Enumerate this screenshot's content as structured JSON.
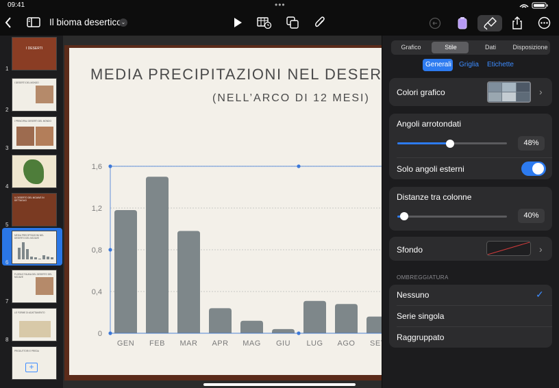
{
  "status_bar": {
    "time": "09:41",
    "center_dots": "•••"
  },
  "toolbar": {
    "document_title": "Il bioma desertico",
    "icons": [
      "back-chevron-icon",
      "sidebar-icon",
      "chevron-down-icon",
      "play-icon",
      "table-insert-icon",
      "shapes-icon",
      "paperclip-icon",
      "undo-icon",
      "collaborate-icon",
      "format-brush-icon",
      "share-icon",
      "more-icon"
    ]
  },
  "sidebar": {
    "slides": [
      {
        "number": "1",
        "title": "I DESERTI"
      },
      {
        "number": "2",
        "title": "I DESERTI DEL MONDO"
      },
      {
        "number": "3",
        "title": "I PRINCIPALI DESERTI DEL MONDO"
      },
      {
        "number": "4",
        "title": ""
      },
      {
        "number": "5",
        "title": "IL DESERTO DEL MOJAVE IN DETTAGLIO"
      },
      {
        "number": "6",
        "title": "MEDIA PRECIPITAZIONI NEL DESERTO DEL MOJAVE"
      },
      {
        "number": "7",
        "title": "FLORA E FAUNA DEL DESERTO DEL MOJAVE"
      },
      {
        "number": "8",
        "title": "LE FORME DI ADATTAMENTO"
      },
      {
        "number": "",
        "title": "PRODUTTORI E PREDA"
      }
    ],
    "selected_index": 5,
    "add_slide_icon": "add-slide-icon"
  },
  "slide": {
    "title": "MEDIA PRECIPITAZIONI NEL DESERTO DEL MOJAVE",
    "subtitle": "(NELL’ARCO DI 12 MESI)"
  },
  "chart_data": {
    "type": "bar",
    "categories": [
      "GEN",
      "FEB",
      "MAR",
      "APR",
      "MAG",
      "GIU",
      "LUG",
      "AGO",
      "SET"
    ],
    "values": [
      1.18,
      1.5,
      0.98,
      0.24,
      0.12,
      0.04,
      0.31,
      0.28,
      0.16
    ],
    "ylim": [
      0,
      1.6
    ],
    "yticks": [
      "0",
      "0,4",
      "0,8",
      "1,2",
      "1,6"
    ],
    "grid": true,
    "bar_color": "#7e878a"
  },
  "panel": {
    "tabs": [
      "Grafico",
      "Stile",
      "Dati",
      "Disposizione"
    ],
    "selected_tab": "Stile",
    "subtabs": [
      "Generali",
      "Griglia",
      "Etichette"
    ],
    "selected_subtab": "Generali",
    "chart_colors_label": "Colori grafico",
    "rounded_corners_label": "Angoli arrotondati",
    "rounded_corners_value": "48%",
    "rounded_corners_fraction": 0.48,
    "outer_corners_label": "Solo angoli esterni",
    "outer_corners_on": true,
    "gap_label": "Distanze tra colonne",
    "gap_value": "40%",
    "gap_fraction": 0.06,
    "background_label": "Sfondo",
    "shading_header": "OMBREGGIATURA",
    "shading_options": [
      "Nessuno",
      "Serie singola",
      "Raggruppato"
    ],
    "shading_selected": "Nessuno"
  },
  "colors": {
    "accent": "#2d7bf0",
    "panel_bg": "#1c1c1e",
    "card_bg": "#2c2c2e"
  }
}
